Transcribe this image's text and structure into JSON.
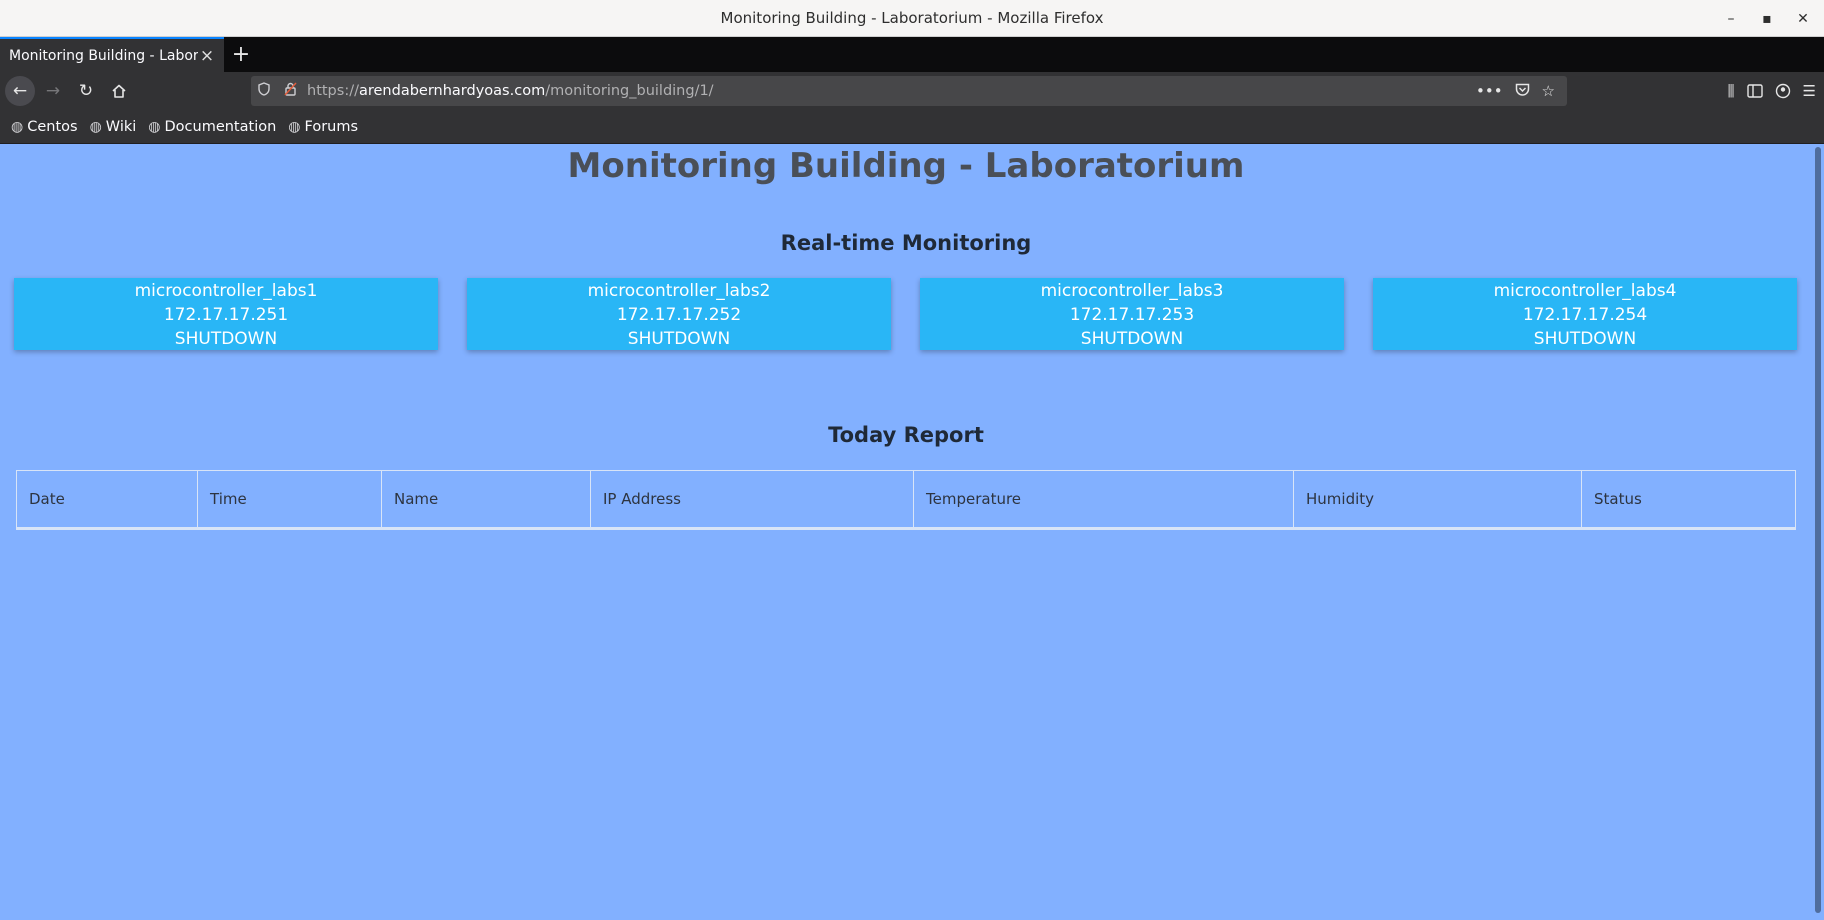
{
  "window": {
    "title": "Monitoring Building - Laboratorium - Mozilla Firefox",
    "controls": {
      "minimize": "–",
      "maximize": "▪",
      "close": "✕"
    }
  },
  "tabs": [
    {
      "label": "Monitoring Building - Laborat",
      "active": true
    }
  ],
  "navigation": {
    "url_scheme": "https://",
    "url_host": "arendabernhardyoas.com",
    "url_path": "/monitoring_building/1/"
  },
  "bookmarks": [
    {
      "label": "Centos",
      "icon": "globe-icon"
    },
    {
      "label": "Wiki",
      "icon": "globe-icon"
    },
    {
      "label": "Documentation",
      "icon": "globe-icon"
    },
    {
      "label": "Forums",
      "icon": "globe-icon"
    }
  ],
  "page": {
    "title": "Monitoring Building - Laboratorium",
    "realtime_heading": "Real-time Monitoring",
    "report_heading": "Today Report",
    "devices": [
      {
        "name": "microcontroller_labs1",
        "ip": "172.17.17.251",
        "status": "SHUTDOWN"
      },
      {
        "name": "microcontroller_labs2",
        "ip": "172.17.17.252",
        "status": "SHUTDOWN"
      },
      {
        "name": "microcontroller_labs3",
        "ip": "172.17.17.253",
        "status": "SHUTDOWN"
      },
      {
        "name": "microcontroller_labs4",
        "ip": "172.17.17.254",
        "status": "SHUTDOWN"
      }
    ],
    "table": {
      "columns": [
        "Date",
        "Time",
        "Name",
        "IP Address",
        "Temperature",
        "Humidity",
        "Status"
      ],
      "rows": []
    }
  },
  "colors": {
    "page_background": "#82b0ff",
    "card_background": "#29b6f6",
    "title_text": "#4a4f57"
  }
}
